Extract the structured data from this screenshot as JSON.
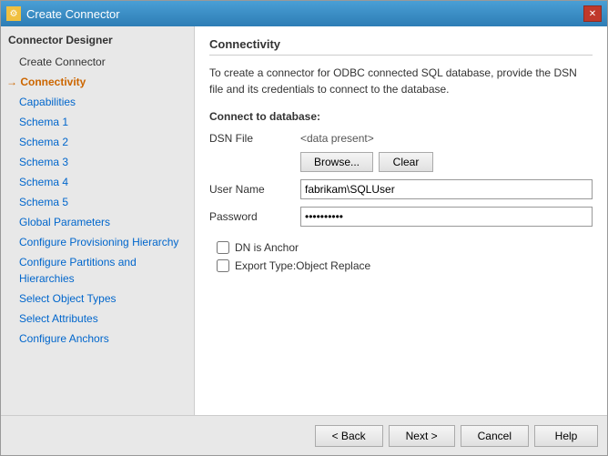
{
  "window": {
    "title": "Create Connector",
    "icon": "⚙"
  },
  "sidebar": {
    "header": "Connector Designer",
    "items": [
      {
        "id": "create-connector",
        "label": "Create Connector",
        "type": "no-link"
      },
      {
        "id": "connectivity",
        "label": "Connectivity",
        "type": "active"
      },
      {
        "id": "capabilities",
        "label": "Capabilities",
        "type": "link"
      },
      {
        "id": "schema1",
        "label": "Schema 1",
        "type": "link"
      },
      {
        "id": "schema2",
        "label": "Schema 2",
        "type": "link"
      },
      {
        "id": "schema3",
        "label": "Schema 3",
        "type": "link"
      },
      {
        "id": "schema4",
        "label": "Schema 4",
        "type": "link"
      },
      {
        "id": "schema5",
        "label": "Schema 5",
        "type": "link"
      },
      {
        "id": "global-parameters",
        "label": "Global Parameters",
        "type": "link"
      },
      {
        "id": "configure-provisioning-hierarchy",
        "label": "Configure Provisioning Hierarchy",
        "type": "link"
      },
      {
        "id": "configure-partitions-and-hierarchies",
        "label": "Configure Partitions and Hierarchies",
        "type": "link"
      },
      {
        "id": "select-object-types",
        "label": "Select Object Types",
        "type": "link"
      },
      {
        "id": "select-attributes",
        "label": "Select Attributes",
        "type": "link"
      },
      {
        "id": "configure-anchors",
        "label": "Configure Anchors",
        "type": "link"
      }
    ]
  },
  "content": {
    "section_title": "Connectivity",
    "description": "To create a connector for ODBC connected SQL database, provide the DSN file and its credentials to connect to the database.",
    "connect_to_label": "Connect to database:",
    "dsn_label": "DSN File",
    "dsn_value": "<data present>",
    "browse_label": "Browse...",
    "clear_label": "Clear",
    "username_label": "User Name",
    "username_value": "fabrikam\\SQLUser",
    "password_label": "Password",
    "password_value": "••••••••••",
    "checkbox1_label": "DN is Anchor",
    "checkbox2_label": "Export Type:Object Replace"
  },
  "footer": {
    "back_label": "< Back",
    "next_label": "Next >",
    "cancel_label": "Cancel",
    "help_label": "Help"
  }
}
